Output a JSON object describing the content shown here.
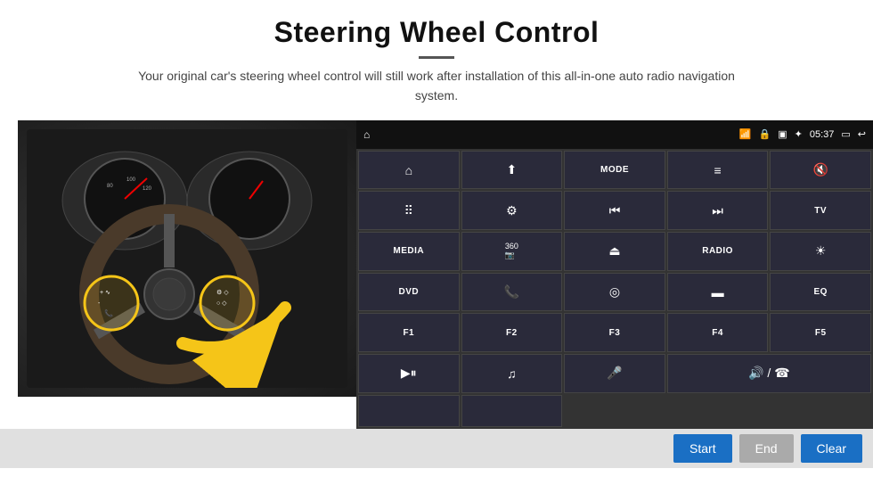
{
  "header": {
    "title": "Steering Wheel Control",
    "subtitle": "Your original car's steering wheel control will still work after installation of this all-in-one auto radio navigation system."
  },
  "statusbar": {
    "time": "05:37",
    "icons": [
      "wifi",
      "lock",
      "sd",
      "bluetooth",
      "nav",
      "back"
    ]
  },
  "grid": {
    "cells": [
      {
        "id": "home",
        "icon": "⌂",
        "text": "",
        "type": "icon"
      },
      {
        "id": "nav-arrow",
        "icon": "↗",
        "text": "",
        "type": "icon"
      },
      {
        "id": "mode",
        "icon": "",
        "text": "MODE",
        "type": "text"
      },
      {
        "id": "list",
        "icon": "☰",
        "text": "",
        "type": "icon"
      },
      {
        "id": "mute",
        "icon": "🔇",
        "text": "",
        "type": "icon"
      },
      {
        "id": "apps",
        "icon": "⠿",
        "text": "",
        "type": "icon"
      },
      {
        "id": "settings2",
        "icon": "⚙",
        "text": "",
        "type": "icon"
      },
      {
        "id": "prev",
        "icon": "⏮",
        "text": "",
        "type": "icon"
      },
      {
        "id": "next",
        "icon": "⏭",
        "text": "",
        "type": "icon"
      },
      {
        "id": "tv",
        "icon": "",
        "text": "TV",
        "type": "text"
      },
      {
        "id": "media",
        "icon": "",
        "text": "MEDIA",
        "type": "text"
      },
      {
        "id": "cam360",
        "icon": "📷",
        "text": "360",
        "type": "icon-text"
      },
      {
        "id": "eject",
        "icon": "⏏",
        "text": "",
        "type": "icon"
      },
      {
        "id": "radio",
        "icon": "",
        "text": "RADIO",
        "type": "text"
      },
      {
        "id": "brightness",
        "icon": "☀",
        "text": "",
        "type": "icon"
      },
      {
        "id": "dvd",
        "icon": "",
        "text": "DVD",
        "type": "text"
      },
      {
        "id": "phone",
        "icon": "📞",
        "text": "",
        "type": "icon"
      },
      {
        "id": "navi",
        "icon": "◎",
        "text": "",
        "type": "icon"
      },
      {
        "id": "rect",
        "icon": "▬",
        "text": "",
        "type": "icon"
      },
      {
        "id": "eq",
        "icon": "",
        "text": "EQ",
        "type": "text"
      },
      {
        "id": "f1",
        "icon": "",
        "text": "F1",
        "type": "text"
      },
      {
        "id": "f2",
        "icon": "",
        "text": "F2",
        "type": "text"
      },
      {
        "id": "f3",
        "icon": "",
        "text": "F3",
        "type": "text"
      },
      {
        "id": "f4",
        "icon": "",
        "text": "F4",
        "type": "text"
      },
      {
        "id": "f5",
        "icon": "",
        "text": "F5",
        "type": "text"
      },
      {
        "id": "play-pause",
        "icon": "▶⏸",
        "text": "",
        "type": "icon"
      },
      {
        "id": "music",
        "icon": "♫",
        "text": "",
        "type": "icon"
      },
      {
        "id": "mic",
        "icon": "🎤",
        "text": "",
        "type": "icon"
      },
      {
        "id": "vol-call",
        "icon": "🔊",
        "text": "",
        "type": "icon-wide"
      }
    ]
  },
  "buttons": {
    "start": "Start",
    "end": "End",
    "clear": "Clear"
  }
}
